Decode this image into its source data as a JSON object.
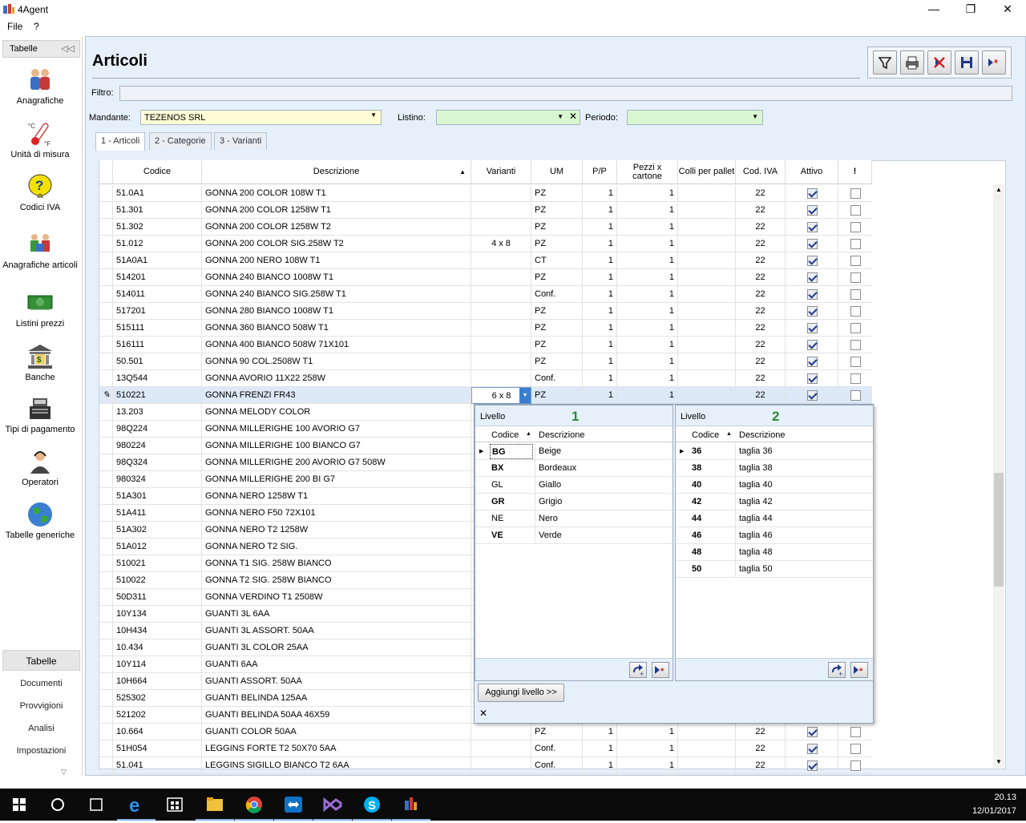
{
  "window": {
    "title": "4Agent"
  },
  "menu": [
    "File",
    "?"
  ],
  "sidebar": {
    "header": "Tabelle",
    "items": [
      {
        "label": "Anagrafiche",
        "icon": "people-icon"
      },
      {
        "label": "Unità di misura",
        "icon": "thermometer-icon"
      },
      {
        "label": "Codici IVA",
        "icon": "question-icon"
      },
      {
        "label": "Anagrafiche articoli",
        "icon": "articles-icon"
      },
      {
        "label": "Listini prezzi",
        "icon": "money-icon"
      },
      {
        "label": "Banche",
        "icon": "bank-icon"
      },
      {
        "label": "Tipi di pagamento",
        "icon": "register-icon"
      },
      {
        "label": "Operatori",
        "icon": "operator-icon"
      },
      {
        "label": "Tabelle generiche",
        "icon": "globe-icon"
      }
    ],
    "nav": [
      "Tabelle",
      "Documenti",
      "Provvigioni",
      "Analisi",
      "Impostazioni"
    ]
  },
  "page": {
    "title": "Articoli"
  },
  "filter": {
    "label": "Filtro:",
    "value": ""
  },
  "mandante": {
    "label": "Mandante:",
    "value": "TEZENOS SRL"
  },
  "listino": {
    "label": "Listino:",
    "value": ""
  },
  "periodo": {
    "label": "Periodo:",
    "value": ""
  },
  "tabs": [
    "1 - Articoli",
    "2 - Categorie",
    "3 - Varianti"
  ],
  "columns": [
    "Codice",
    "Descrizione",
    "Varianti",
    "UM",
    "P/P",
    "Pezzi x cartone",
    "Colli per pallet",
    "Cod. IVA",
    "Attivo",
    "!"
  ],
  "rows": [
    {
      "codice": "51.0A1",
      "descr": "GONNA 200 COLOR 108W T1",
      "var": "",
      "um": "PZ",
      "pp": "1",
      "pezzi": "1",
      "iva": "22",
      "attivo": true
    },
    {
      "codice": "51.301",
      "descr": "GONNA 200 COLOR 1258W T1",
      "var": "",
      "um": "PZ",
      "pp": "1",
      "pezzi": "1",
      "iva": "22",
      "attivo": true
    },
    {
      "codice": "51.302",
      "descr": "GONNA 200 COLOR 1258W T2",
      "var": "",
      "um": "PZ",
      "pp": "1",
      "pezzi": "1",
      "iva": "22",
      "attivo": true
    },
    {
      "codice": "51.012",
      "descr": "GONNA 200 COLOR SIG.258W T2",
      "var": "4 x 8",
      "um": "PZ",
      "pp": "1",
      "pezzi": "1",
      "iva": "22",
      "attivo": true
    },
    {
      "codice": "51A0A1",
      "descr": "GONNA 200 NERO 108W T1",
      "var": "",
      "um": "CT",
      "pp": "1",
      "pezzi": "1",
      "iva": "22",
      "attivo": true
    },
    {
      "codice": "514201",
      "descr": "GONNA 240 BIANCO 1008W T1",
      "var": "",
      "um": "PZ",
      "pp": "1",
      "pezzi": "1",
      "iva": "22",
      "attivo": true
    },
    {
      "codice": "514011",
      "descr": "GONNA 240 BIANCO SIG.258W T1",
      "var": "",
      "um": "Conf.",
      "pp": "1",
      "pezzi": "1",
      "iva": "22",
      "attivo": true
    },
    {
      "codice": "517201",
      "descr": "GONNA 280 BIANCO 1008W T1",
      "var": "",
      "um": "PZ",
      "pp": "1",
      "pezzi": "1",
      "iva": "22",
      "attivo": true
    },
    {
      "codice": "515111",
      "descr": "GONNA 360 BIANCO 508W T1",
      "var": "",
      "um": "PZ",
      "pp": "1",
      "pezzi": "1",
      "iva": "22",
      "attivo": true
    },
    {
      "codice": "516111",
      "descr": "GONNA 400 BIANCO 508W 71X101",
      "var": "",
      "um": "PZ",
      "pp": "1",
      "pezzi": "1",
      "iva": "22",
      "attivo": true
    },
    {
      "codice": "50.501",
      "descr": "GONNA 90 COL.2508W T1",
      "var": "",
      "um": "PZ",
      "pp": "1",
      "pezzi": "1",
      "iva": "22",
      "attivo": true
    },
    {
      "codice": "13Q544",
      "descr": "GONNA AVORIO 11X22 258W",
      "var": "",
      "um": "Conf.",
      "pp": "1",
      "pezzi": "1",
      "iva": "22",
      "attivo": true
    },
    {
      "codice": "510221",
      "descr": "GONNA FRENZI FR43",
      "var": "6 x 8",
      "um": "PZ",
      "pp": "1",
      "pezzi": "1",
      "iva": "22",
      "attivo": true,
      "selected": true
    },
    {
      "codice": "13.203",
      "descr": "GONNA MELODY COLOR"
    },
    {
      "codice": "98Q224",
      "descr": "GONNA MILLERIGHE 100 AVORIO G7"
    },
    {
      "codice": "980224",
      "descr": "GONNA MILLERIGHE 100 BIANCO G7"
    },
    {
      "codice": "98Q324",
      "descr": "GONNA MILLERIGHE 200 AVORIO G7 508W"
    },
    {
      "codice": "980324",
      "descr": "GONNA MILLERIGHE 200 BI G7"
    },
    {
      "codice": "51A301",
      "descr": "GONNA NERO 1258W T1"
    },
    {
      "codice": "51A411",
      "descr": "GONNA NERO F50 72X101"
    },
    {
      "codice": "51A302",
      "descr": "GONNA NERO T2 1258W"
    },
    {
      "codice": "51A012",
      "descr": "GONNA NERO T2 SIG."
    },
    {
      "codice": "510021",
      "descr": "GONNA T1 SIG. 258W BIANCO"
    },
    {
      "codice": "510022",
      "descr": "GONNA T2 SIG. 258W BIANCO"
    },
    {
      "codice": "50D311",
      "descr": "GONNA VERDINO T1 2508W"
    },
    {
      "codice": "10Y134",
      "descr": "GUANTI 3L 6AA"
    },
    {
      "codice": "10H434",
      "descr": "GUANTI 3L ASSORT. 50AA"
    },
    {
      "codice": "10.434",
      "descr": "GUANTI 3L COLOR 25AA"
    },
    {
      "codice": "10Y114",
      "descr": "GUANTI 6AA"
    },
    {
      "codice": "10H664",
      "descr": "GUANTI ASSORT. 50AA"
    },
    {
      "codice": "525302",
      "descr": "GUANTI BELINDA 125AA"
    },
    {
      "codice": "521202",
      "descr": "GUANTI BELINDA 50AA 46X59"
    },
    {
      "codice": "10.664",
      "descr": "GUANTI COLOR 50AA",
      "var": "",
      "um": "PZ",
      "pp": "1",
      "pezzi": "1",
      "iva": "22",
      "attivo": true
    },
    {
      "codice": "51H054",
      "descr": "LEGGINS FORTE T2 50X70 5AA",
      "var": "",
      "um": "Conf.",
      "pp": "1",
      "pezzi": "1",
      "iva": "22",
      "attivo": true
    },
    {
      "codice": "51.041",
      "descr": "LEGGINS SIGILLO BIANCO T2 6AA",
      "var": "",
      "um": "Conf.",
      "pp": "1",
      "pezzi": "1",
      "iva": "22",
      "attivo": true
    }
  ],
  "popup": {
    "level1": {
      "label": "Livello",
      "num": "1",
      "col1": "Codice",
      "col2": "Descrizione",
      "rows": [
        {
          "c": "BG",
          "d": "Beige",
          "bold": true
        },
        {
          "c": "BX",
          "d": "Bordeaux",
          "bold": true
        },
        {
          "c": "GL",
          "d": "Giallo",
          "bold": false
        },
        {
          "c": "GR",
          "d": "Grigio",
          "bold": true
        },
        {
          "c": "NE",
          "d": "Nero",
          "bold": false
        },
        {
          "c": "VE",
          "d": "Verde",
          "bold": true
        }
      ]
    },
    "level2": {
      "label": "Livello",
      "num": "2",
      "col1": "Codice",
      "col2": "Descrizione",
      "rows": [
        {
          "c": "36",
          "d": "taglia 36"
        },
        {
          "c": "38",
          "d": "taglia 38"
        },
        {
          "c": "40",
          "d": "taglia 40"
        },
        {
          "c": "42",
          "d": "taglia 42"
        },
        {
          "c": "44",
          "d": "taglia 44"
        },
        {
          "c": "46",
          "d": "taglia 46"
        },
        {
          "c": "48",
          "d": "taglia 48"
        },
        {
          "c": "50",
          "d": "taglia 50"
        }
      ]
    },
    "add_level": "Aggiungi livello >>",
    "close": "✕"
  },
  "taskbar": {
    "time": "20.13",
    "date": "12/01/2017"
  }
}
